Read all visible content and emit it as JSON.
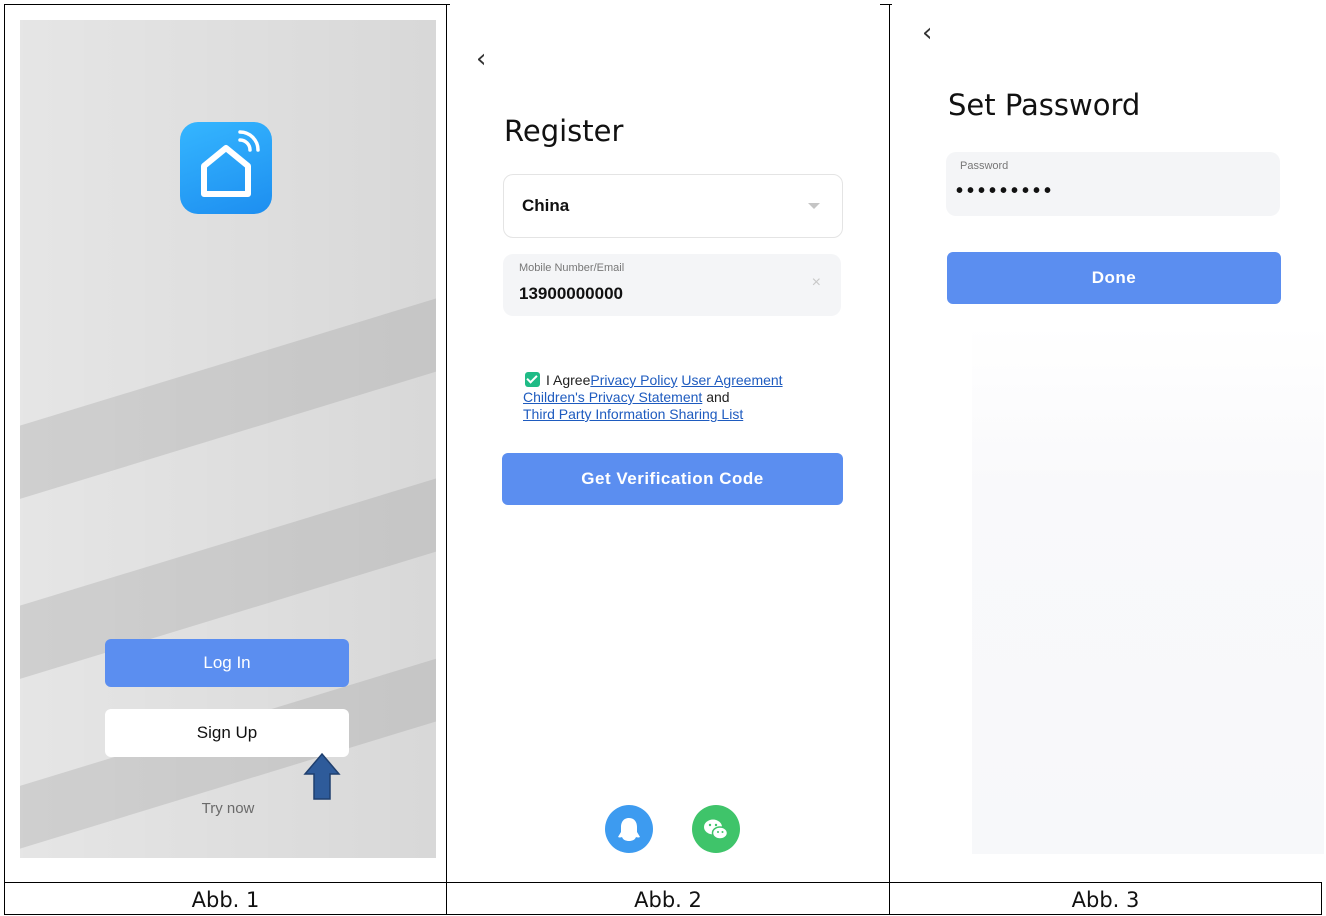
{
  "panel1": {
    "login_label": "Log In",
    "signup_label": "Sign Up",
    "try_now_label": "Try now",
    "app_icon": "smart-home-icon",
    "arrow_icon": "arrow-up-icon"
  },
  "panel2": {
    "back_icon": "‹",
    "title": "Register",
    "country_value": "China",
    "mobile_label": "Mobile Number/Email",
    "mobile_value": "13900000000",
    "clear_icon": "×",
    "agree_prefix": "I Agree",
    "privacy_policy": "Privacy Policy",
    "user_agreement": "User Agreement",
    "childrens_privacy": "Children's Privacy Statement",
    "and_text": "and",
    "third_party": "Third Party Information Sharing List",
    "verify_button": "Get Verification Code",
    "social_qq": "qq-icon",
    "social_wechat": "wechat-icon"
  },
  "panel3": {
    "back_icon": "‹",
    "title": "Set Password",
    "password_label": "Password",
    "password_value": "•••••••••",
    "done_button": "Done"
  },
  "captions": [
    "Abb. 1",
    "Abb. 2",
    "Abb. 3"
  ],
  "colors": {
    "primary": "#5b8ef0",
    "checkbox": "#1fbb86",
    "link": "#1e5bbf",
    "qq": "#3d9bf0",
    "wechat": "#3fc46a"
  }
}
